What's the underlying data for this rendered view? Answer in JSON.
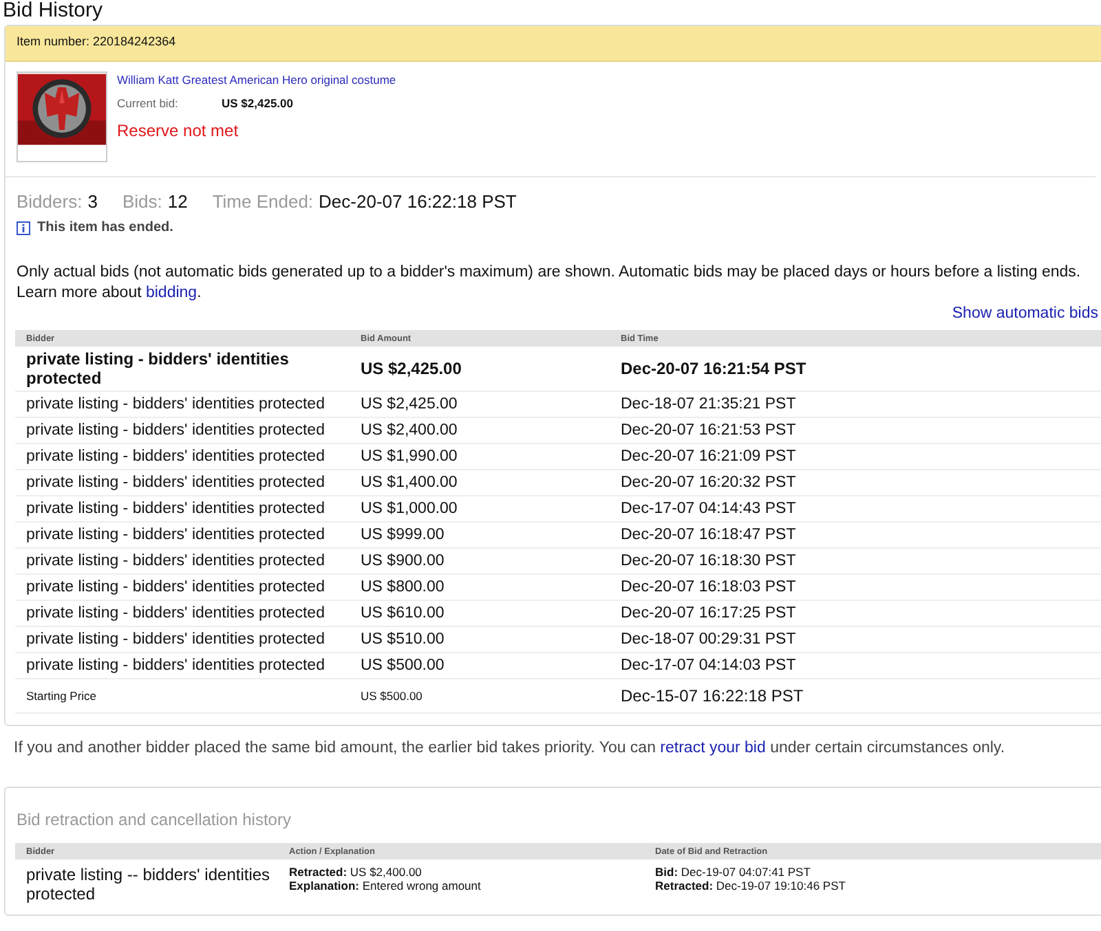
{
  "page_title": "Bid History",
  "item": {
    "number_label": "Item number:",
    "number": "220184242364",
    "title": "William Katt Greatest American Hero original costume",
    "current_bid_label": "Current bid:",
    "current_bid": "US $2,425.00",
    "reserve": "Reserve not met"
  },
  "stats": [
    {
      "label": "Bidders:",
      "value": "3"
    },
    {
      "label": "Bids:",
      "value": "12"
    },
    {
      "label": "Time Ended:",
      "value": "Dec-20-07 16:22:18 PST"
    }
  ],
  "notice": "This item has ended.",
  "intro": {
    "text": "Only actual bids (not automatic bids generated up to a bidder's maximum) are shown. Automatic bids may be placed days or hours before a listing ends. Learn more about",
    "link": "bidding",
    "after": "."
  },
  "show_automatic_link": "Show automatic bids",
  "bids_table": {
    "columns": [
      "Bidder",
      "Bid Amount",
      "Bid Time"
    ],
    "rows": [
      {
        "kind": "winning",
        "bidder": "private listing - bidders' identities protected",
        "amount": "US $2,425.00",
        "time": "Dec-20-07 16:21:54 PST"
      },
      {
        "kind": "bid",
        "bidder": "private listing - bidders' identities protected",
        "amount": "US $2,425.00",
        "time": "Dec-18-07 21:35:21 PST"
      },
      {
        "kind": "bid",
        "bidder": "private listing - bidders' identities protected",
        "amount": "US $2,400.00",
        "time": "Dec-20-07 16:21:53 PST"
      },
      {
        "kind": "bid",
        "bidder": "private listing - bidders' identities protected",
        "amount": "US $1,990.00",
        "time": "Dec-20-07 16:21:09 PST"
      },
      {
        "kind": "bid",
        "bidder": "private listing - bidders' identities protected",
        "amount": "US $1,400.00",
        "time": "Dec-20-07 16:20:32 PST"
      },
      {
        "kind": "bid",
        "bidder": "private listing - bidders' identities protected",
        "amount": "US $1,000.00",
        "time": "Dec-17-07 04:14:43 PST"
      },
      {
        "kind": "bid",
        "bidder": "private listing - bidders' identities protected",
        "amount": "US $999.00",
        "time": "Dec-20-07 16:18:47 PST"
      },
      {
        "kind": "bid",
        "bidder": "private listing - bidders' identities protected",
        "amount": "US $900.00",
        "time": "Dec-20-07 16:18:30 PST"
      },
      {
        "kind": "bid",
        "bidder": "private listing - bidders' identities protected",
        "amount": "US $800.00",
        "time": "Dec-20-07 16:18:03 PST"
      },
      {
        "kind": "bid",
        "bidder": "private listing - bidders' identities protected",
        "amount": "US $610.00",
        "time": "Dec-20-07 16:17:25 PST"
      },
      {
        "kind": "bid",
        "bidder": "private listing - bidders' identities protected",
        "amount": "US $510.00",
        "time": "Dec-18-07 00:29:31 PST"
      },
      {
        "kind": "bid",
        "bidder": "private listing - bidders' identities protected",
        "amount": "US $500.00",
        "time": "Dec-17-07 04:14:03 PST"
      },
      {
        "kind": "starting",
        "bidder": "Starting Price",
        "amount": "US $500.00",
        "time": "Dec-15-07 16:22:18 PST"
      }
    ]
  },
  "priority_note": {
    "text": "If you and another bidder placed the same bid amount, the earlier bid takes priority. You can",
    "link": "retract your bid",
    "after": "under certain circumstances only."
  },
  "retraction": {
    "title": "Bid retraction and cancellation history",
    "columns": [
      "Bidder",
      "Action / Explanation",
      "Date of Bid and Retraction"
    ],
    "rows": [
      {
        "bidder": "private listing -- bidders' identities protected",
        "action": [
          {
            "label": "Retracted:",
            "value": "US $2,400.00"
          },
          {
            "label": "Explanation:",
            "value": "Entered wrong amount"
          }
        ],
        "dates": [
          {
            "label": "Bid:",
            "value": "Dec-19-07 04:07:41 PST"
          },
          {
            "label": "Retracted:",
            "value": "Dec-19-07 19:10:46 PST"
          }
        ]
      }
    ]
  }
}
